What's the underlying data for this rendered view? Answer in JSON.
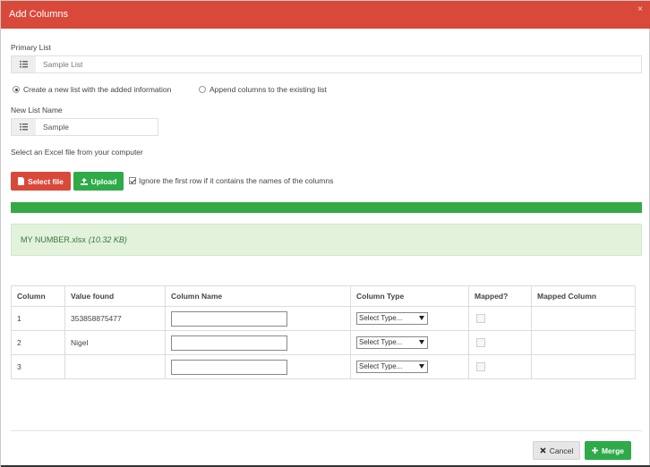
{
  "header": {
    "title": "Add Columns",
    "close_glyph": "×"
  },
  "primary_list": {
    "label": "Primary List",
    "value": "Sample List",
    "icon": "list-icon"
  },
  "mode": {
    "option_new": "Create a new list with the added information",
    "option_append": "Append columns to the existing list",
    "selected": "new"
  },
  "new_list": {
    "label": "New List Name",
    "value": "Sample",
    "icon": "list-icon"
  },
  "file_section": {
    "label": "Select an Excel file from your computer",
    "select_button": "Select file",
    "upload_button": "Upload",
    "ignore_first_row": "Ignore the first row if it contains the names of the columns",
    "ignore_first_row_checked": true
  },
  "progress": {
    "percent": 100,
    "color": "#36a946"
  },
  "uploaded_file": {
    "name": "MY NUMBER.xlsx",
    "size": "(10.32 KB)"
  },
  "table": {
    "headers": [
      "Column",
      "Value found",
      "Column Name",
      "Column Type",
      "Mapped?",
      "Mapped Column"
    ],
    "rows": [
      {
        "column": "1",
        "value_found": "353858875477",
        "column_name": "",
        "column_type": "Select Type...",
        "mapped": false,
        "mapped_column": ""
      },
      {
        "column": "2",
        "value_found": "Nigel",
        "column_name": "",
        "column_type": "Select Type...",
        "mapped": false,
        "mapped_column": ""
      },
      {
        "column": "3",
        "value_found": "",
        "column_name": "",
        "column_type": "Select Type...",
        "mapped": false,
        "mapped_column": ""
      }
    ]
  },
  "footer": {
    "cancel_label": "Cancel",
    "merge_label": "Merge"
  },
  "colors": {
    "header": "#d9493a",
    "danger": "#d9493a",
    "success": "#2faa48",
    "alert_bg": "#e2f2dd"
  }
}
